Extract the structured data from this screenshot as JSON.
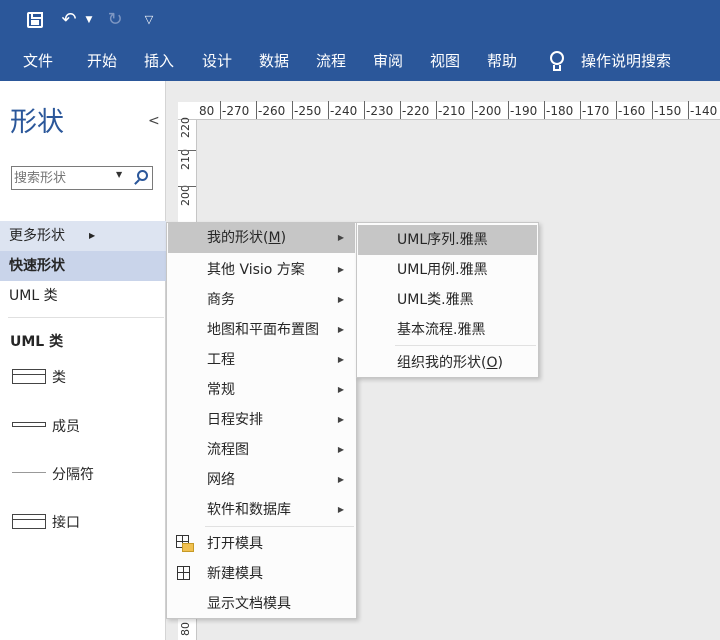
{
  "quick_access": {
    "save_icon": "save-icon",
    "undo_icon": "undo-icon",
    "redo_icon": "redo-icon",
    "customize_icon": "chevron-down-icon"
  },
  "ribbon": {
    "tabs": [
      "文件",
      "开始",
      "插入",
      "设计",
      "数据",
      "流程",
      "审阅",
      "视图",
      "帮助"
    ],
    "tell_me": "操作说明搜索",
    "color": "#2b579a"
  },
  "shapes_pane": {
    "title": "形状",
    "search_placeholder": "搜索形状",
    "more_shapes": "更多形状",
    "quick_shapes": "快速形状",
    "uml_class": "UML 类",
    "stencil_title": "UML 类",
    "stencil_items": [
      "类",
      "成员",
      "分隔符",
      "接口"
    ]
  },
  "ruler": {
    "horizontal": [
      "80",
      "-270",
      "-260",
      "-250",
      "-240",
      "-230",
      "-220",
      "-210",
      "-200",
      "-190",
      "-180",
      "-170",
      "-160",
      "-150",
      "-140"
    ],
    "vertical": [
      "220",
      "210",
      "200",
      "80"
    ]
  },
  "main_menu": {
    "items": [
      {
        "label": "我的形状(",
        "accel": "M",
        "close": ")"
      },
      {
        "label": "其他 Visio 方案"
      },
      {
        "label": "商务"
      },
      {
        "label": "地图和平面布置图"
      },
      {
        "label": "工程"
      },
      {
        "label": "常规"
      },
      {
        "label": "日程安排"
      },
      {
        "label": "流程图"
      },
      {
        "label": "网络"
      },
      {
        "label": "软件和数据库"
      }
    ],
    "open_stencil": "打开模具",
    "new_stencil": "新建模具",
    "show_doc_stencil": "显示文档模具"
  },
  "sub_menu": {
    "items": [
      "UML序列.雅黑",
      "UML用例.雅黑",
      "UML类.雅黑",
      "基本流程.雅黑"
    ],
    "organize_label": "组织我的形状(",
    "organize_accel": "O",
    "organize_close": ")"
  }
}
